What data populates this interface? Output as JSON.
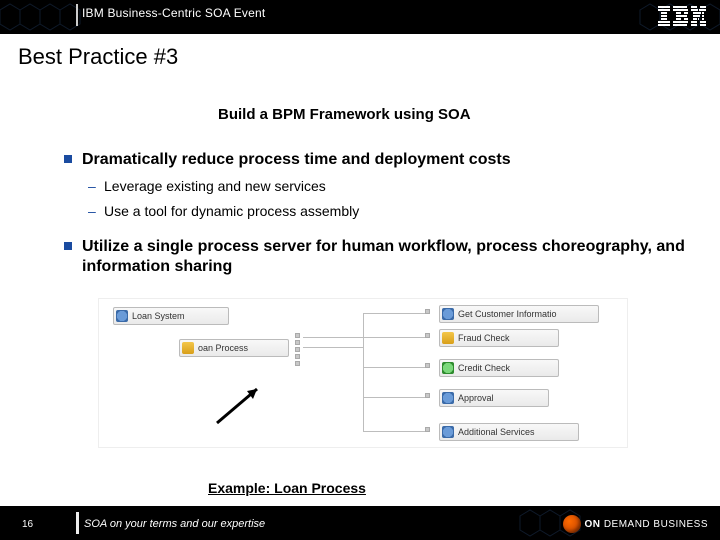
{
  "header": {
    "event_title": "IBM Business-Centric SOA Event",
    "logo_label": "IBM"
  },
  "title": "Best Practice #3",
  "subtitle": "Build a BPM Framework using SOA",
  "bullets": [
    {
      "text": "Dramatically reduce process time and deployment costs",
      "sub": [
        "Leverage existing and new services",
        "Use a tool for dynamic process assembly"
      ]
    },
    {
      "text": "Utilize a single process server for human workflow, process choreography, and information sharing",
      "sub": []
    }
  ],
  "diagram": {
    "left_nodes": [
      {
        "label": "Loan System",
        "icon": "gear"
      },
      {
        "label": "oan Process",
        "icon": "db"
      }
    ],
    "right_nodes": [
      {
        "label": "Get Customer Informatio",
        "icon": "gear"
      },
      {
        "label": "Fraud Check",
        "icon": "db"
      },
      {
        "label": "Credit Check",
        "icon": "green"
      },
      {
        "label": "Approval",
        "icon": "gear"
      },
      {
        "label": "Additional Services",
        "icon": "gear"
      }
    ]
  },
  "example_label": "Example: Loan Process",
  "footer": {
    "page": "16",
    "tagline": "SOA on your terms and our expertise",
    "badge_on": "ON",
    "badge_demand": "DEMAND BUSINESS"
  }
}
